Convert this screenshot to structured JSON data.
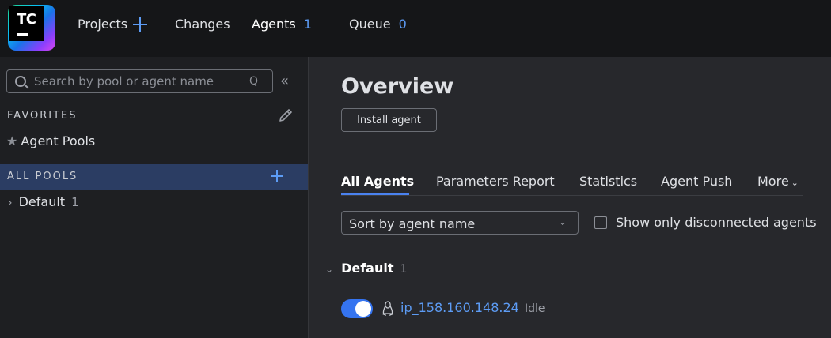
{
  "logo": {
    "text": "TC"
  },
  "nav": {
    "projects": "Projects",
    "changes": "Changes",
    "agents": "Agents",
    "agents_count": "1",
    "queue": "Queue",
    "queue_count": "0"
  },
  "sidebar": {
    "search_placeholder": "Search by pool or agent name",
    "search_shortcut": "Q",
    "collapse_glyph": "«",
    "favorites_heading": "FAVORITES",
    "favorite_item": "Agent Pools",
    "all_pools_heading": "ALL POOLS",
    "pools": [
      {
        "name": "Default",
        "count": "1"
      }
    ]
  },
  "main": {
    "title": "Overview",
    "install_button": "Install agent",
    "tabs": [
      "All Agents",
      "Parameters Report",
      "Statistics",
      "Agent Push",
      "More"
    ],
    "sort_value": "Sort by agent name",
    "disconnected_label": "Show only disconnected agents",
    "group": {
      "name": "Default",
      "count": "1"
    },
    "agent": {
      "name": "ip_158.160.148.24",
      "status": "Idle",
      "enabled": true
    }
  },
  "colors": {
    "topbar_bg": "#151618",
    "sidebar_bg": "#1e1f22",
    "main_bg": "#27282c",
    "accent": "#5d9cf5",
    "selected_row": "#2b3d63",
    "toggle_on": "#3574f0"
  },
  "icons": [
    "plus-icon",
    "search-icon",
    "collapse-icon",
    "pencil-icon",
    "star-icon",
    "chevron-right-icon",
    "chevron-down-icon",
    "linux-icon"
  ]
}
